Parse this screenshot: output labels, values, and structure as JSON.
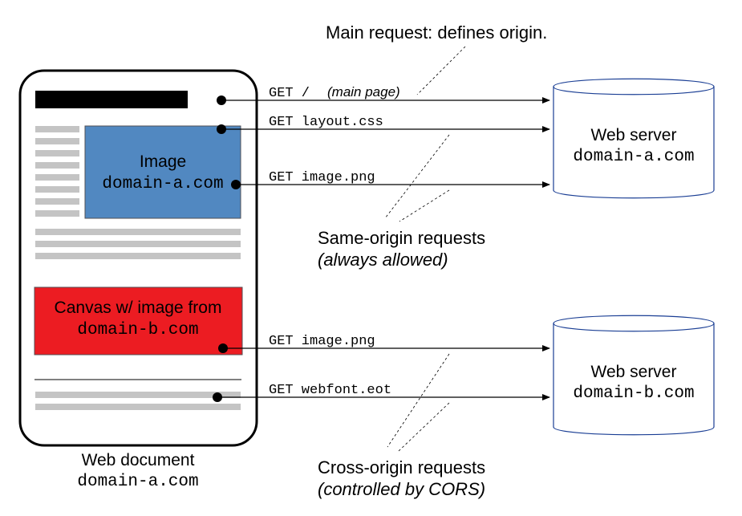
{
  "diagram": {
    "topLabel": "Main request: defines origin.",
    "document": {
      "caption1": "Web document",
      "caption2": "domain-a.com",
      "imageBox": {
        "line1": "Image",
        "line2": "domain-a.com"
      },
      "canvasBox": {
        "line1": "Canvas w/ image from",
        "line2": "domain-b.com"
      }
    },
    "requests": {
      "r1_get": "GET /",
      "r1_note": "(main page)",
      "r2": "GET layout.css",
      "r3": "GET image.png",
      "r4": "GET image.png",
      "r5": "GET webfont.eot"
    },
    "groups": {
      "same": {
        "title": "Same-origin requests",
        "sub": "(always allowed)"
      },
      "cross": {
        "title": "Cross-origin requests",
        "sub": "(controlled by CORS)"
      }
    },
    "servers": {
      "a": {
        "title": "Web server",
        "domain": "domain-a.com"
      },
      "b": {
        "title": "Web server",
        "domain": "domain-b.com"
      }
    }
  }
}
